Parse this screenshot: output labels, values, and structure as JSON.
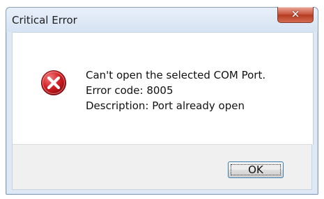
{
  "window": {
    "title": "Critical Error",
    "close_icon": "close-icon"
  },
  "message": {
    "line1": "Can't open the selected COM Port.",
    "line2": "Error code: 8005",
    "line3": "Description: Port already open",
    "icon": "error-icon"
  },
  "buttons": {
    "ok_label": "OK"
  },
  "colors": {
    "error_red": "#c7161b",
    "close_button_red": "#c9543b",
    "focus_blue": "#3c7fb1"
  }
}
